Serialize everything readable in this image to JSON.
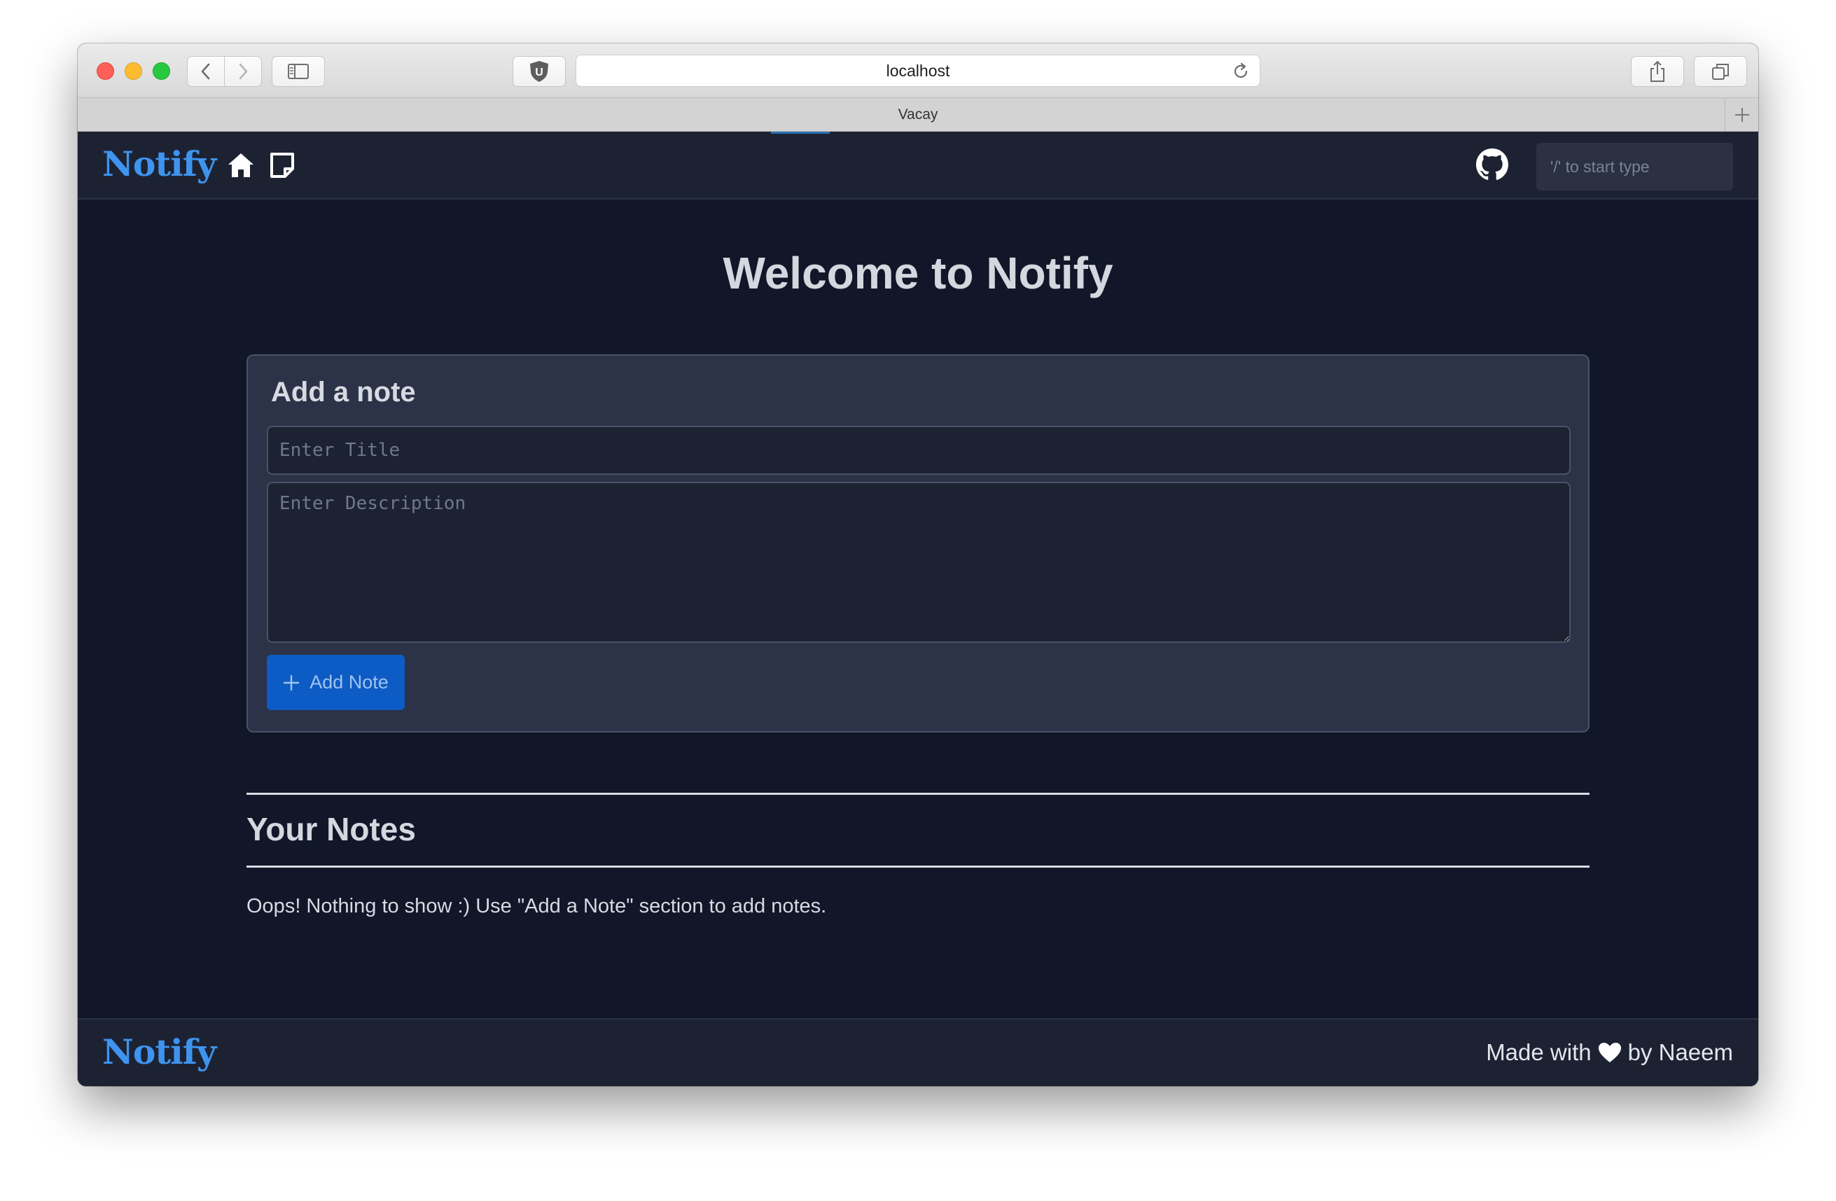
{
  "browser": {
    "url": "localhost",
    "tab_title": "Vacay",
    "shield_label": "U"
  },
  "navbar": {
    "brand": "Notify",
    "search_placeholder": "'/' to start type",
    "icons": [
      "home-icon",
      "note-icon",
      "github-icon"
    ]
  },
  "main": {
    "welcome": "Welcome to Notify",
    "add_card": {
      "title": "Add a note",
      "title_placeholder": "Enter Title",
      "description_placeholder": "Enter Description",
      "button_label": "Add Note"
    },
    "notes_heading": "Your Notes",
    "empty_message": "Oops! Nothing to show :) Use \"Add a Note\" section to add notes."
  },
  "footer": {
    "brand": "Notify",
    "made_with": "Made with",
    "by": "by Naeem"
  },
  "colors": {
    "brand": "#3e94ee",
    "background": "#111729",
    "surface": "#1d2233",
    "card": "#2c3247",
    "button": "#0d5bc4"
  }
}
